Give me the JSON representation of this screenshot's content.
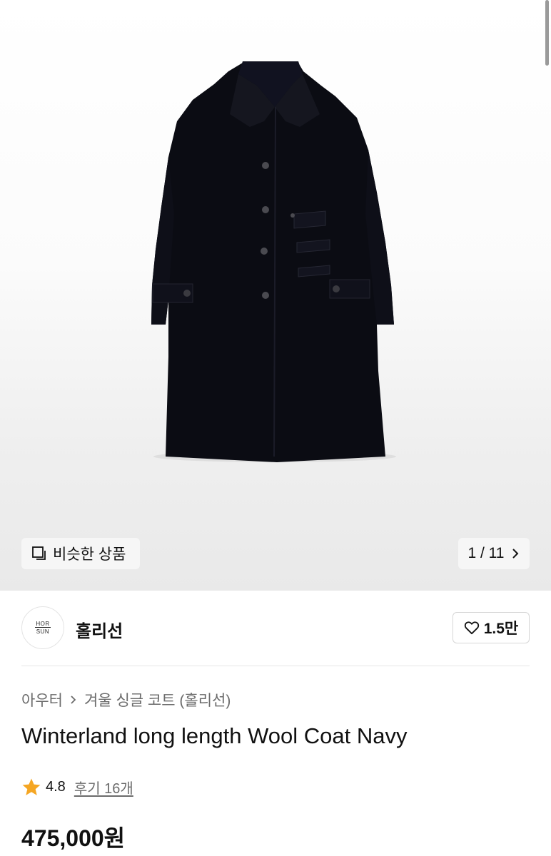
{
  "gallery": {
    "similar_label": "비슷한 상품",
    "counter": "1 / 11"
  },
  "brand": {
    "logo_line1": "HOR",
    "logo_line2": "SUN",
    "name": "홀리선",
    "like_count": "1.5만"
  },
  "product": {
    "breadcrumb": [
      "아우터",
      "겨울 싱글 코트 (홀리선)"
    ],
    "title": "Winterland long length Wool Coat Navy",
    "rating": "4.8",
    "reviews": "후기 16개",
    "price": "475,000원"
  },
  "colors": {
    "star": "#f5a623",
    "coat": "#0b0c13"
  },
  "icons": {
    "similar": "copy-square-icon",
    "next": "chevron-right-icon",
    "like": "heart-outline-icon",
    "rating": "star-icon",
    "breadcrumb_sep": "chevron-right-icon"
  }
}
